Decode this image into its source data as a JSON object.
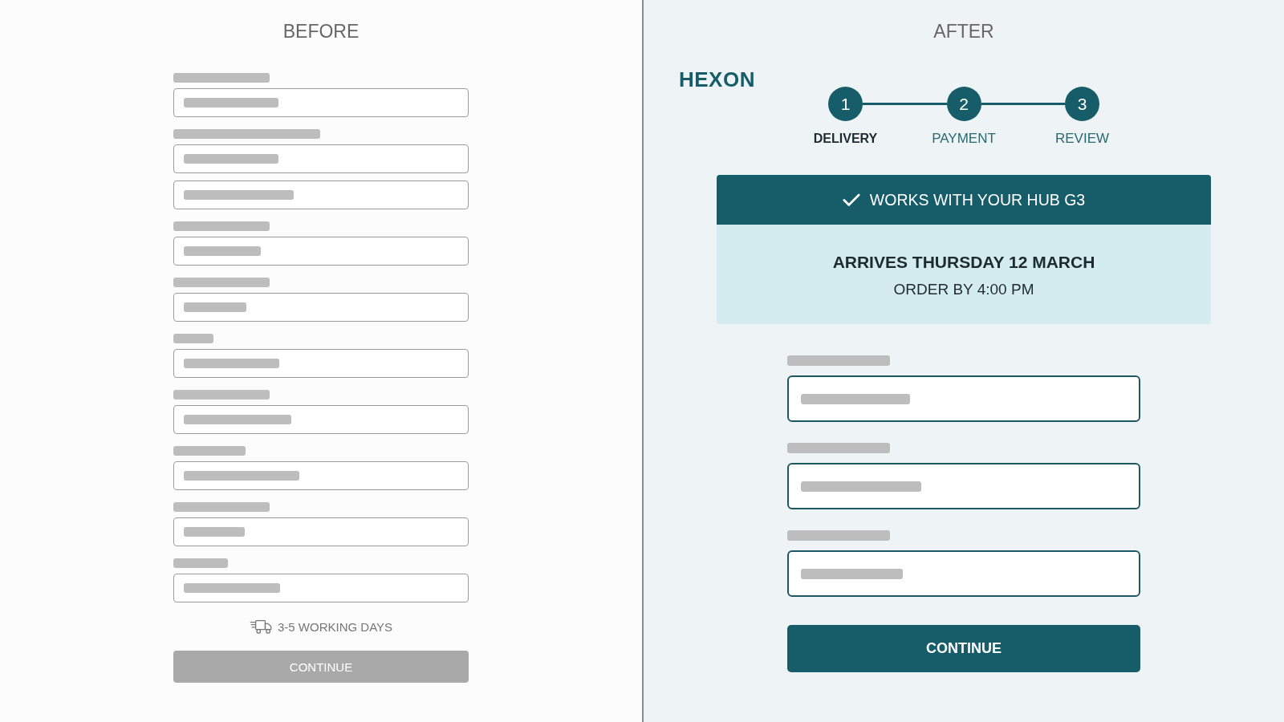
{
  "before": {
    "title": "BEFORE",
    "fields": [
      {
        "kind": "labeled"
      },
      {
        "kind": "labeled"
      },
      {
        "kind": "continuation"
      },
      {
        "kind": "labeled"
      },
      {
        "kind": "labeled"
      },
      {
        "kind": "labeled"
      },
      {
        "kind": "labeled"
      },
      {
        "kind": "labeled"
      },
      {
        "kind": "labeled"
      },
      {
        "kind": "labeled"
      }
    ],
    "delivery_note": "3-5 WORKING DAYS",
    "button": "CONTINUE"
  },
  "after": {
    "title": "AFTER",
    "logo": "HEXON",
    "steps": [
      {
        "number": "1",
        "label": "DELIVERY",
        "selected": true
      },
      {
        "number": "2",
        "label": "PAYMENT",
        "selected": false
      },
      {
        "number": "3",
        "label": "REVIEW",
        "selected": false
      }
    ],
    "banner": {
      "heading": "WORKS WITH YOUR HUB G3",
      "delivery_date": "ARRIVES THURSDAY 12 MARCH",
      "order_deadline": "ORDER BY 4:00 PM"
    },
    "fields": [
      {
        "kind": "labeled"
      },
      {
        "kind": "labeled"
      },
      {
        "kind": "labeled"
      }
    ],
    "button": "CONTINUE"
  }
}
